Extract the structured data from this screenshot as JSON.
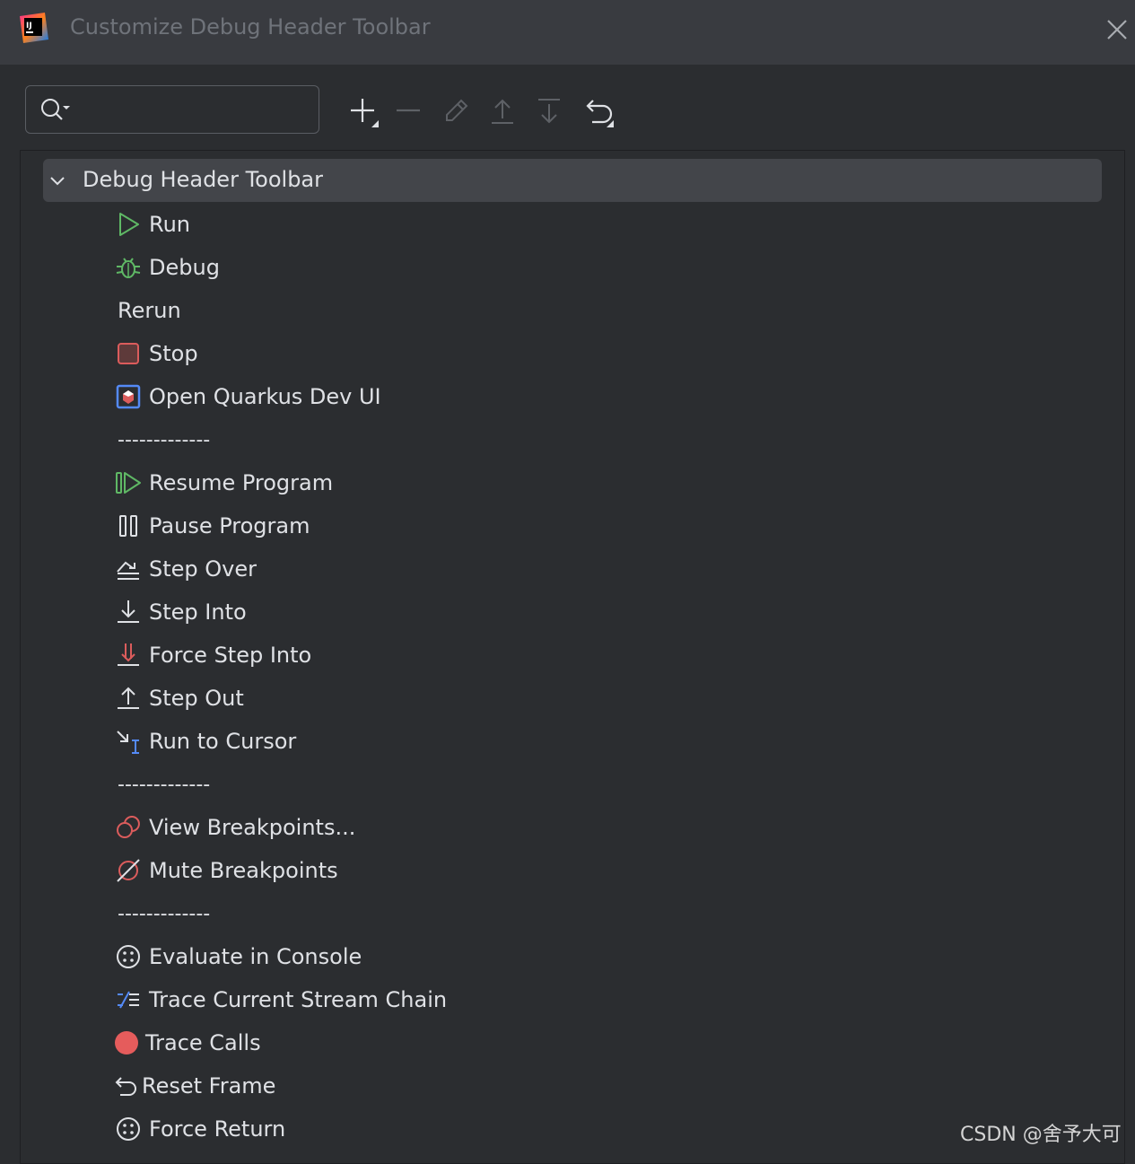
{
  "window": {
    "title": "Customize Debug Header Toolbar"
  },
  "toolbar": {
    "search_value": "",
    "buttons": [
      {
        "name": "add-icon",
        "enabled": true
      },
      {
        "name": "remove-icon",
        "enabled": false
      },
      {
        "name": "edit-icon",
        "enabled": false
      },
      {
        "name": "move-up-icon",
        "enabled": false
      },
      {
        "name": "move-down-icon",
        "enabled": false
      },
      {
        "name": "restore-icon",
        "enabled": true
      }
    ]
  },
  "tree": {
    "root_label": "Debug Header Toolbar",
    "items": [
      {
        "label": "Run",
        "icon": "run-icon"
      },
      {
        "label": "Debug",
        "icon": "debug-icon"
      },
      {
        "label": "Rerun",
        "icon": ""
      },
      {
        "label": "Stop",
        "icon": "stop-icon"
      },
      {
        "label": "Open Quarkus Dev UI",
        "icon": "quarkus-icon"
      },
      {
        "label": "-------------",
        "icon": ""
      },
      {
        "label": "Resume Program",
        "icon": "resume-icon"
      },
      {
        "label": "Pause Program",
        "icon": "pause-icon"
      },
      {
        "label": "Step Over",
        "icon": "step-over-icon"
      },
      {
        "label": "Step Into",
        "icon": "step-into-icon"
      },
      {
        "label": "Force Step Into",
        "icon": "force-step-into-icon"
      },
      {
        "label": "Step Out",
        "icon": "step-out-icon"
      },
      {
        "label": "Run to Cursor",
        "icon": "run-to-cursor-icon"
      },
      {
        "label": "-------------",
        "icon": ""
      },
      {
        "label": "View Breakpoints...",
        "icon": "view-breakpoints-icon"
      },
      {
        "label": "Mute Breakpoints",
        "icon": "mute-breakpoints-icon"
      },
      {
        "label": "-------------",
        "icon": ""
      },
      {
        "label": "Evaluate in Console",
        "icon": "evaluate-icon"
      },
      {
        "label": "Trace Current Stream Chain",
        "icon": "trace-stream-icon"
      },
      {
        "label": "Trace Calls",
        "icon": "trace-calls-icon"
      },
      {
        "label": "Reset Frame",
        "icon": "reset-frame-icon"
      },
      {
        "label": "Force Return",
        "icon": "force-return-icon"
      }
    ]
  },
  "watermark": "CSDN @舍予大可",
  "colors": {
    "background": "#2b2d30",
    "titlebar": "#393b40",
    "selection": "#43454a",
    "text": "#dfe1e5",
    "green": "#5fb865",
    "red": "#db5c5c",
    "blue": "#548af7"
  }
}
